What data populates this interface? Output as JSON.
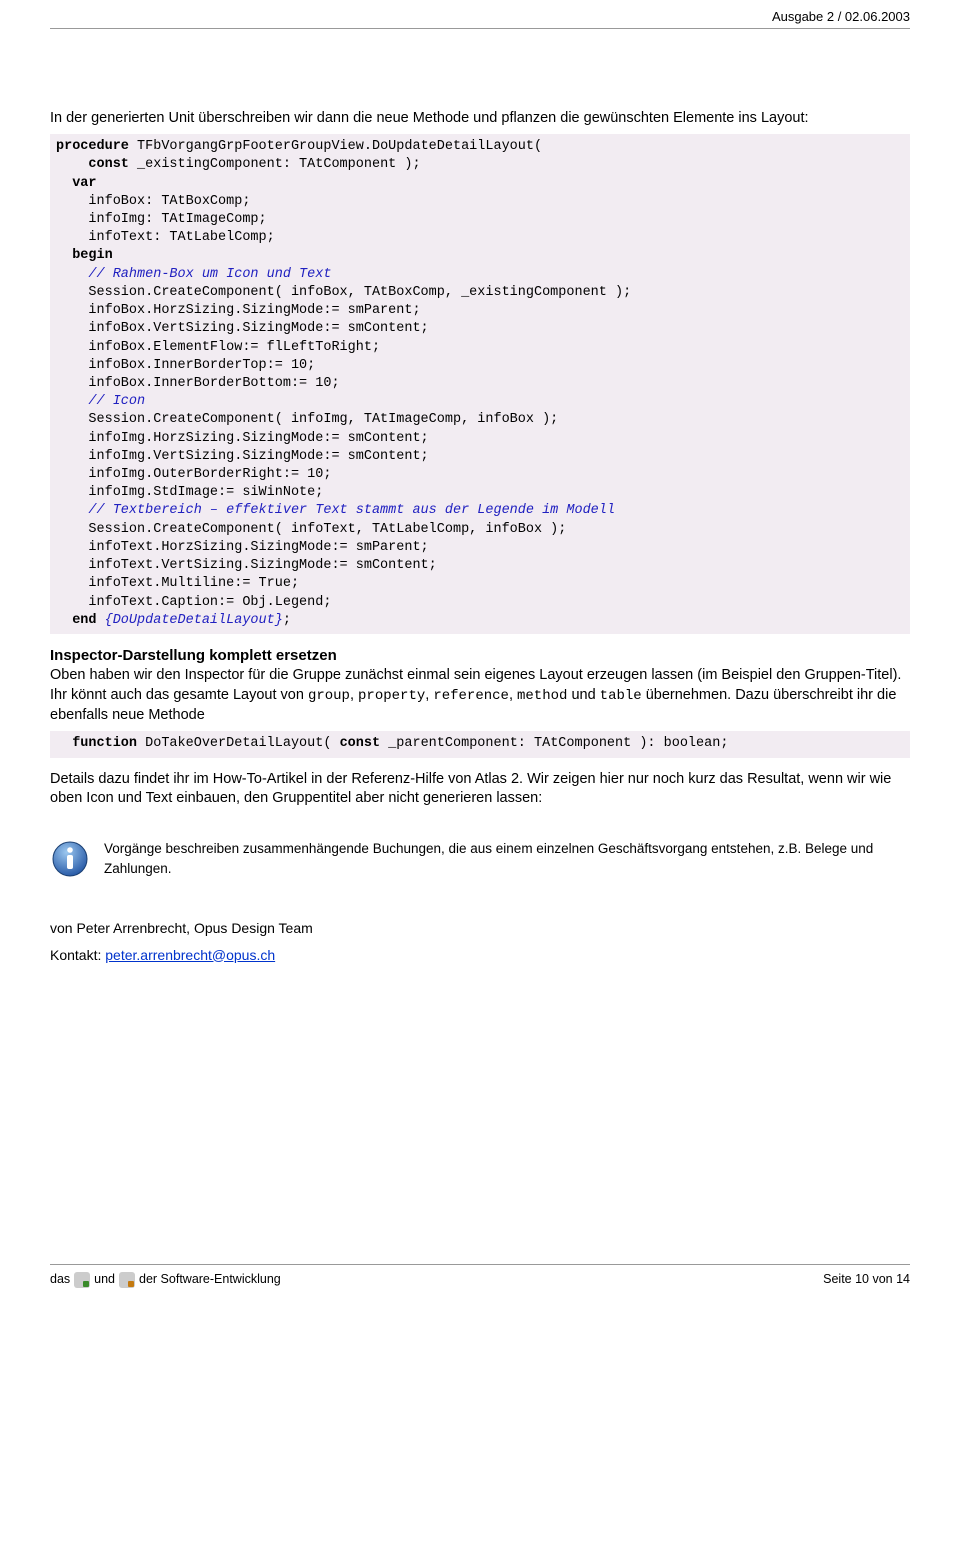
{
  "header": {
    "issue": "Ausgabe 2 / 02.06.2003"
  },
  "intro": "In der generierten Unit überschreiben wir dann die neue Methode und pflanzen die gewünschten Elemente ins Layout:",
  "code1": {
    "l1a": "procedure",
    "l1b": " TFbVorgangGrpFooterGroupView.DoUpdateDetailLayout(",
    "l2a": "    const",
    "l2b": " _existingComponent: TAtComponent );",
    "l3a": "  var",
    "l3b": "",
    "l4": "    infoBox: TAtBoxComp;",
    "l5": "    infoImg: TAtImageComp;",
    "l6": "    infoText: TAtLabelComp;",
    "l7a": "  begin",
    "l7b": "",
    "c1": "    // Rahmen-Box um Icon und Text",
    "l8": "    Session.CreateComponent( infoBox, TAtBoxComp, _existingComponent );",
    "l9": "    infoBox.HorzSizing.SizingMode:= smParent;",
    "l10": "    infoBox.VertSizing.SizingMode:= smContent;",
    "l11": "    infoBox.ElementFlow:= flLeftToRight;",
    "l12": "    infoBox.InnerBorderTop:= 10;",
    "l13": "    infoBox.InnerBorderBottom:= 10;",
    "c2": "    // Icon",
    "l14": "    Session.CreateComponent( infoImg, TAtImageComp, infoBox );",
    "l15": "    infoImg.HorzSizing.SizingMode:= smContent;",
    "l16": "    infoImg.VertSizing.SizingMode:= smContent;",
    "l17": "    infoImg.OuterBorderRight:= 10;",
    "l18": "    infoImg.StdImage:= siWinNote;",
    "c3": "    // Textbereich – effektiver Text stammt aus der Legende im Modell",
    "l19": "    Session.CreateComponent( infoText, TAtLabelComp, infoBox );",
    "l20": "    infoText.HorzSizing.SizingMode:= smParent;",
    "l21": "    infoText.VertSizing.SizingMode:= smContent;",
    "l22": "    infoText.Multiline:= True;",
    "l23": "    infoText.Caption:= Obj.Legend;",
    "l24a": "  end ",
    "l24b": "{DoUpdateDetailLayout}",
    "l24c": ";"
  },
  "section2": {
    "title": "Inspector-Darstellung komplett ersetzen",
    "p1a": "Oben haben wir den Inspector für die Gruppe zunächst einmal sein eigenes Layout erzeugen lassen (im Beispiel den Gruppen-Titel). Ihr könnt auch das gesamte Layout von ",
    "p1b": "group",
    "p1c": ", ",
    "p1d": "property",
    "p1e": ", ",
    "p1f": "reference",
    "p1g": ", ",
    "p1h": "method",
    "p1i": " und ",
    "p1j": "table",
    "p1k": " übernehmen. Dazu überschreibt ihr die ebenfalls neue Methode"
  },
  "code2": {
    "l1a": "  function",
    "l1b": " DoTakeOverDetailLayout( ",
    "l1c": "const",
    "l1d": " _parentComponent: TAtComponent ): boolean;"
  },
  "followup": "Details dazu findet ihr im How-To-Artikel in der Referenz-Hilfe von Atlas 2. Wir zeigen hier nur noch kurz das Resultat, wenn wir wie oben Icon und Text einbauen, den Gruppentitel aber nicht generieren lassen:",
  "infobox": "Vorgänge beschreiben zusammenhängende Buchungen, die aus einem einzelnen Geschäftsvorgang entstehen, z.B. Belege und Zahlungen.",
  "author": {
    "line1": "von Peter Arrenbrecht, Opus Design Team",
    "label": "Kontakt: ",
    "email": "peter.arrenbrecht@opus.ch"
  },
  "footer": {
    "w1": "das",
    "w2": "und",
    "w3": "der Software-Entwicklung",
    "page": "Seite 10 von 14"
  }
}
